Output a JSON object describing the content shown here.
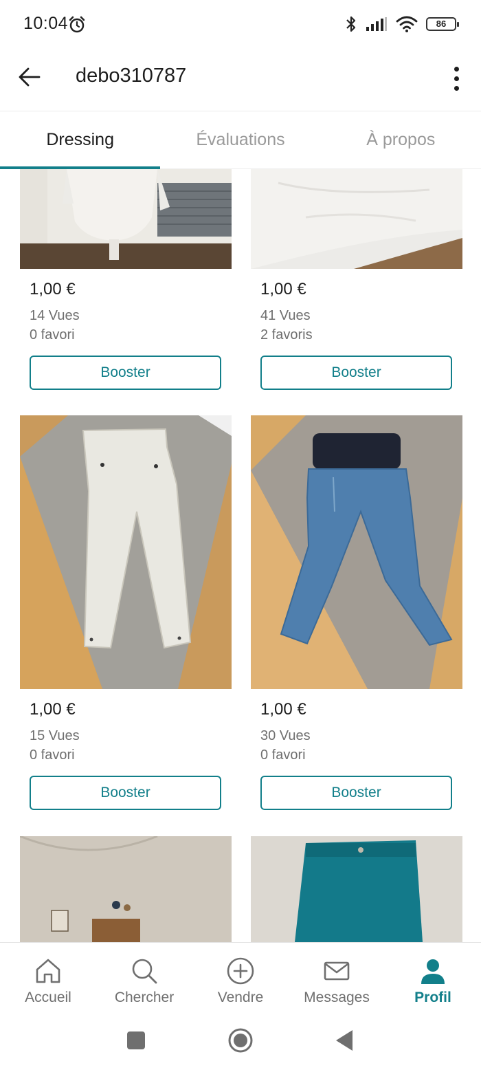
{
  "status_bar": {
    "time": "10:04",
    "battery": "86",
    "icons": [
      "alarm-icon",
      "bluetooth-icon",
      "signal-icon",
      "wifi-icon",
      "battery-icon"
    ]
  },
  "header": {
    "title": "debo310787",
    "back_icon": "arrow-left-icon",
    "more_icon": "more-vertical-icon"
  },
  "tabs": [
    {
      "label": "Dressing",
      "active": true
    },
    {
      "label": "Évaluations",
      "active": false
    },
    {
      "label": "À propos",
      "active": false
    }
  ],
  "items": [
    {
      "price": "1,00 €",
      "views": "14 Vues",
      "favorites": "0 favori",
      "button": "Booster"
    },
    {
      "price": "1,00 €",
      "views": "41 Vues",
      "favorites": "2 favoris",
      "button": "Booster"
    },
    {
      "price": "1,00 €",
      "views": "15 Vues",
      "favorites": "0 favori",
      "button": "Booster"
    },
    {
      "price": "1,00 €",
      "views": "30 Vues",
      "favorites": "0 favori",
      "button": "Booster"
    }
  ],
  "bottom_nav": [
    {
      "label": "Accueil",
      "icon": "home-icon",
      "active": false
    },
    {
      "label": "Chercher",
      "icon": "search-icon",
      "active": false
    },
    {
      "label": "Vendre",
      "icon": "plus-circle-icon",
      "active": false
    },
    {
      "label": "Messages",
      "icon": "mail-icon",
      "active": false
    },
    {
      "label": "Profil",
      "icon": "person-icon",
      "active": true
    }
  ],
  "colors": {
    "accent": "#127f8a",
    "text": "#1d1d1d",
    "muted": "#6f6f6f"
  }
}
